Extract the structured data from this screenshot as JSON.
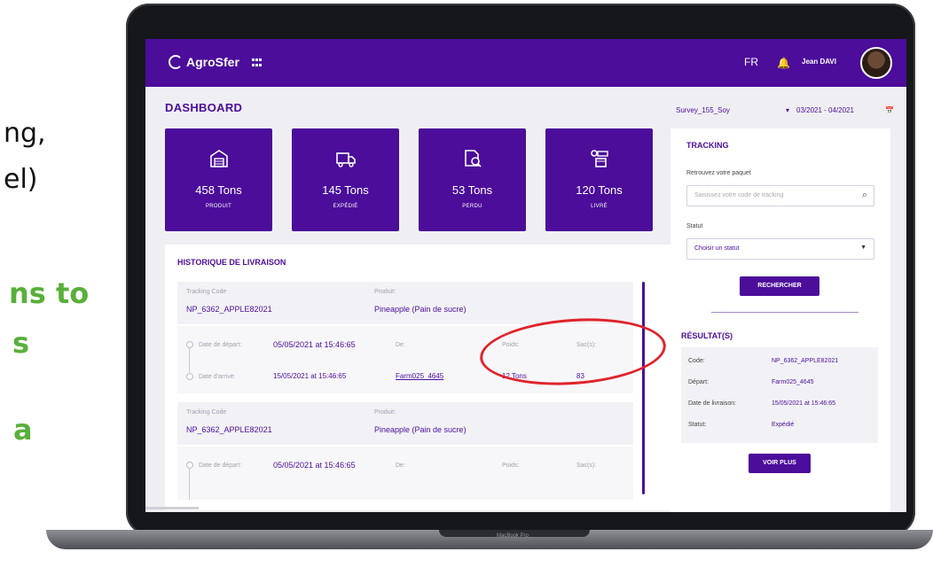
{
  "side_text": {
    "line1": "ng,",
    "line2": "el)",
    "line3": "ns to",
    "line4": "s",
    "line5": "a"
  },
  "app": {
    "brand": "AgroSfer",
    "language": "FR",
    "user_name": "Jean DAVI"
  },
  "dashboard": {
    "title": "DASHBOARD",
    "survey_select": "Survey_155_Soy",
    "date_range": "03/2021 - 04/2021"
  },
  "stats": [
    {
      "value": "458 Tons",
      "label": "PRODUIT",
      "icon": "warehouse-icon"
    },
    {
      "value": "145 Tons",
      "label": "EXPÉDIÉ",
      "icon": "truck-icon"
    },
    {
      "value": "53 Tons",
      "label": "PERDU",
      "icon": "document-search-icon"
    },
    {
      "value": "120 Tons",
      "label": "LIVRÉ",
      "icon": "delivery-box-icon"
    }
  ],
  "history": {
    "title": "HISTORIQUE DE LIVRAISON",
    "records": [
      {
        "tracking_label": "Tracking Code",
        "tracking_code": "NP_6362_APPLE82021",
        "product_label": "Produit:",
        "product": "Pineapple (Pain de sucre)",
        "depart_label": "Date de départ:",
        "depart": "05/05/2021 at 15:46:65",
        "arrival_label": "Date d'arrivé:",
        "arrival": "15/05/2021 at 15:46:65",
        "from_label": "De:",
        "from": "Farm025_4645",
        "weight_label": "Poids:",
        "weight": "12 Tons",
        "bags_label": "Sac(s):",
        "bags": "83"
      },
      {
        "tracking_label": "Tracking Code",
        "tracking_code": "NP_6362_APPLE82021",
        "product_label": "Produit:",
        "product": "Pineapple (Pain de sucre)",
        "depart_label": "Date de départ:",
        "depart": "05/05/2021 at 15:46:65",
        "from_label": "De:",
        "weight_label": "Poids:",
        "bags_label": "Sac(s):"
      }
    ]
  },
  "tracking": {
    "title": "TRACKING",
    "subtitle": "Retrouvez votre paquet",
    "search_placeholder": "Saisissez votre code de tracking",
    "status_label": "Statut",
    "status_value": "Choisir un statut",
    "search_button": "RECHERCHER",
    "result_title": "RÉSULTAT(S)",
    "results": [
      {
        "key": "Code:",
        "value": "NP_6362_APPLE82021"
      },
      {
        "key": "Départ:",
        "value": "Farm025_4645"
      },
      {
        "key": "Date de livraison:",
        "value": "15/05/2021 at 15:46:65"
      },
      {
        "key": "Statut:",
        "value": "Expédié"
      }
    ],
    "more_button": "VOIR PLUS"
  },
  "laptop_label": "MacBook Pro",
  "colors": {
    "brand_purple": "#4b0d9a",
    "accent_green": "#58b03a",
    "annotation_red": "#e0232b"
  }
}
